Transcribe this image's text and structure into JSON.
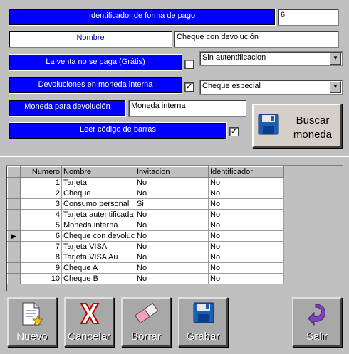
{
  "form": {
    "identificador_label": "Identificador de forma de pago",
    "identificador_value": "6",
    "nombre_label": "Nombre",
    "nombre_value": "Cheque con devolución",
    "venta_label": "La venta no se paga (Grátis)",
    "venta_checked": "",
    "autentificacion_value": "Sin autentificacion",
    "devoluciones_label": "Devoluciones en moneda interna",
    "devoluciones_checked": "✓",
    "cheque_select_value": "Cheque especial",
    "moneda_label": "Moneda para devolución",
    "moneda_value": "Moneda interna",
    "leer_label": "Leer código de barras",
    "leer_checked": "✓",
    "buscar_label_1": "Buscar",
    "buscar_label_2": "moneda"
  },
  "grid": {
    "columns": [
      "Numero",
      "Nombre",
      "Invitacion",
      "Identificador"
    ],
    "current_row_marker": "▶",
    "rows": [
      [
        "1",
        "Tarjeta",
        "No",
        "No"
      ],
      [
        "2",
        "Cheque",
        "No",
        "No"
      ],
      [
        "3",
        "Consumo personal",
        "Si",
        "No"
      ],
      [
        "4",
        "Tarjeta autentificada",
        "No",
        "No"
      ],
      [
        "5",
        "Moneda interna",
        "No",
        "No"
      ],
      [
        "6",
        "Cheque con devolución",
        "No",
        "No"
      ],
      [
        "7",
        "Tarjeta VISA",
        "No",
        "No"
      ],
      [
        "8",
        "Tarjeta VISA Au",
        "No",
        "No"
      ],
      [
        "9",
        "Cheque A",
        "No",
        "No"
      ],
      [
        "10",
        "Cheque B",
        "No",
        "No"
      ]
    ]
  },
  "toolbar": {
    "nuevo": "Nuevo",
    "cancelar": "Cancelar",
    "borrar": "Borrar",
    "grabar": "Grabar",
    "salir": "Salir"
  }
}
